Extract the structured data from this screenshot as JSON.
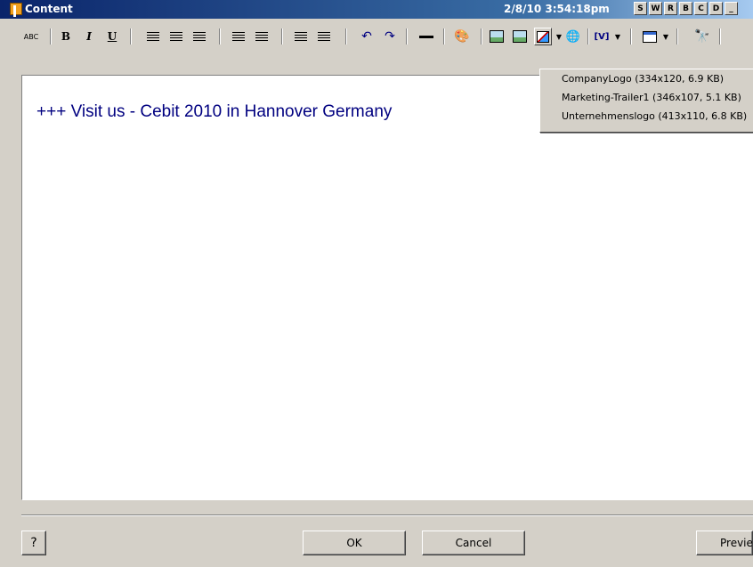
{
  "window": {
    "title": "Content",
    "timestamp": "2/8/10 3:54:18pm",
    "title_buttons": [
      "S",
      "W",
      "R",
      "B",
      "C",
      "D"
    ]
  },
  "toolbar": {
    "spellcheck_label": "ABC",
    "bold_label": "B",
    "italic_label": "I",
    "underline_label": "U",
    "variable_label": "[V]"
  },
  "editor": {
    "content": "+++ Visit us - Cebit 2010 in Hannover Germany"
  },
  "image_dropdown": {
    "items": [
      "CompanyLogo (334x120, 6.9 KB)",
      "Marketing-Trailer1 (346x107, 5.1 KB)",
      "Unternehmenslogo (413x110, 6.8 KB)"
    ]
  },
  "buttons": {
    "ok": "OK",
    "cancel": "Cancel",
    "preview": "Preview"
  },
  "colors": {
    "title_gradient_start": "#0a246a",
    "title_gradient_end": "#a6caf0",
    "content_text": "#000080",
    "dialog_bg": "#d4d0c8"
  }
}
